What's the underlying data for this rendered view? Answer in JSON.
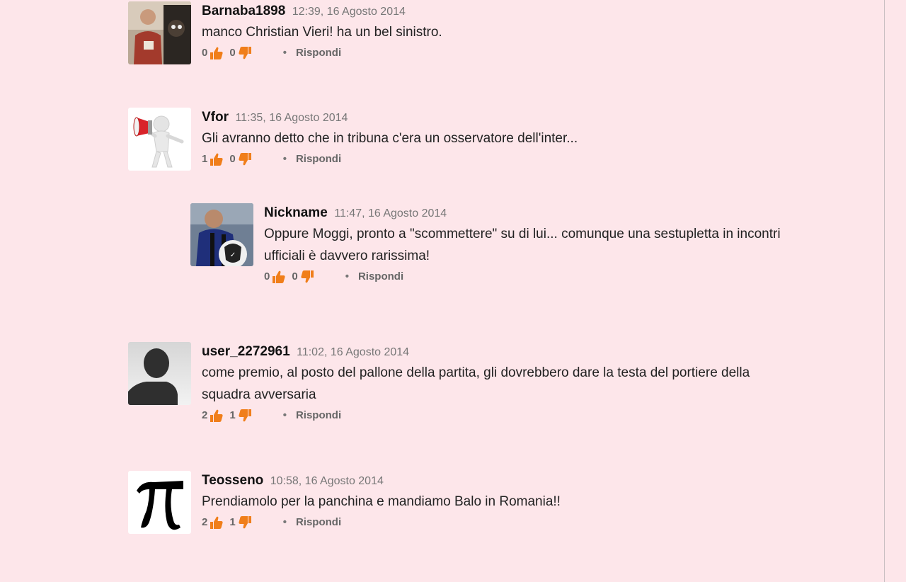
{
  "comments": [
    {
      "author": "Barnaba1898",
      "time": "12:39, 16 Agosto 2014",
      "text": "manco Christian Vieri! ha un bel sinistro.",
      "likes": "0",
      "dislikes": "0",
      "reply_label": "Rispondi"
    },
    {
      "author": "Vfor",
      "time": "11:35, 16 Agosto 2014",
      "text": "Gli avranno detto che in tribuna c'era un osservatore dell'inter...",
      "likes": "1",
      "dislikes": "0",
      "reply_label": "Rispondi"
    },
    {
      "author": "Nickname",
      "time": "11:47, 16 Agosto 2014",
      "text": "Oppure Moggi, pronto a \"scommettere\" su di lui... comunque una sestupletta in incontri ufficiali è davvero rarissima!",
      "likes": "0",
      "dislikes": "0",
      "reply_label": "Rispondi"
    },
    {
      "author": "user_2272961",
      "time": "11:02, 16 Agosto 2014",
      "text": "come premio, al posto del pallone della partita, gli dovrebbero dare la testa del portiere della squadra avversaria",
      "likes": "2",
      "dislikes": "1",
      "reply_label": "Rispondi"
    },
    {
      "author": "Teosseno",
      "time": "10:58, 16 Agosto 2014",
      "text": "Prendiamolo per la panchina e mandiamo Balo in Romania!!",
      "likes": "2",
      "dislikes": "1",
      "reply_label": "Rispondi"
    }
  ],
  "colors": {
    "background": "#fde6ea",
    "thumb": "#f07e1a",
    "author": "#111111",
    "meta": "#777777"
  },
  "icons": {
    "like": "thumbs-up-icon",
    "dislike": "thumbs-down-icon"
  }
}
